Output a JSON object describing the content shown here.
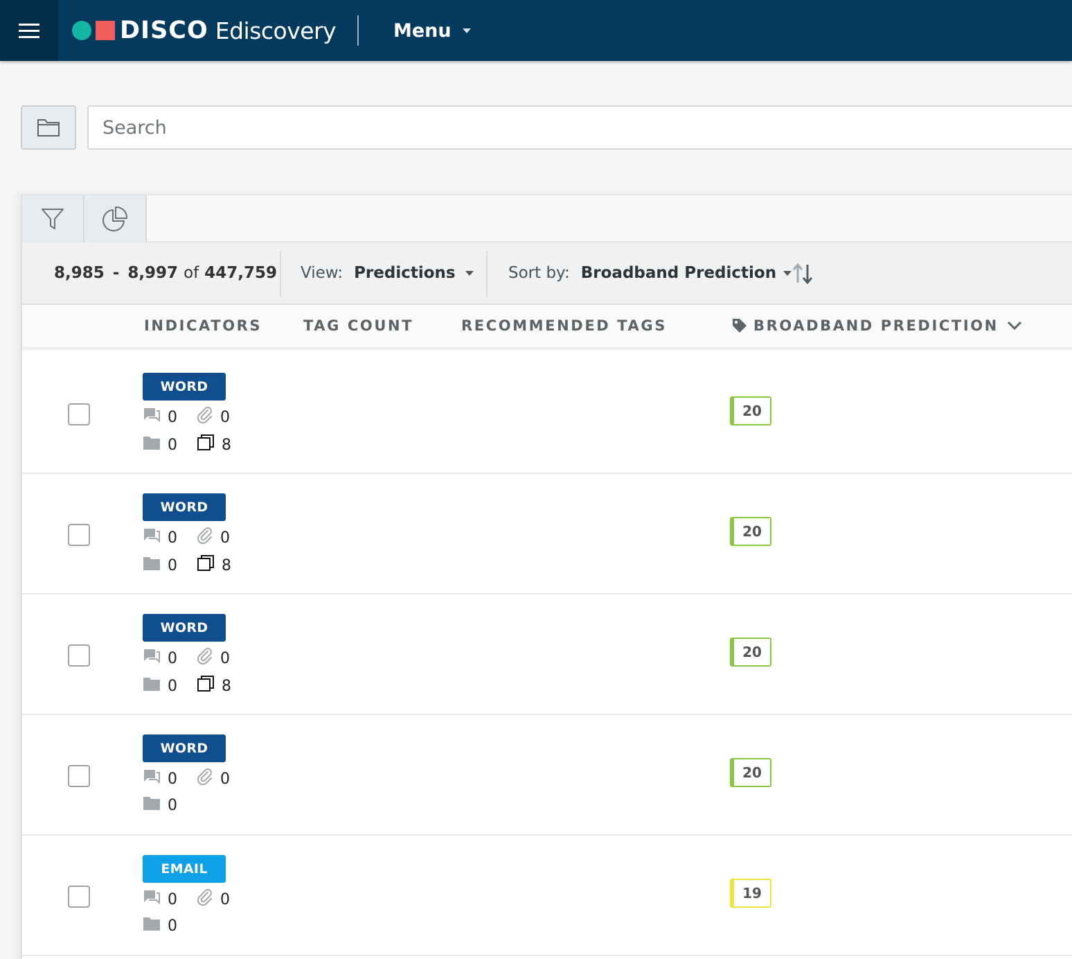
{
  "nav": {
    "brand": "DISCO",
    "product": "Ediscovery",
    "menu_label": "Menu",
    "colors": {
      "bar": "#033a5e",
      "logo_dot": "#13b6a4",
      "logo_square": "#f25d5d"
    }
  },
  "search": {
    "placeholder": "Search",
    "value": ""
  },
  "toolbar": {
    "range_start": "8,985",
    "range_sep": "-",
    "range_end": "8,997",
    "range_of": "of",
    "total": "447,759",
    "view_label": "View:",
    "view_value": "Predictions",
    "sort_label": "Sort by:",
    "sort_value": "Broadband Prediction"
  },
  "columns": {
    "indicators": "INDICATORS",
    "tag_count": "TAG COUNT",
    "recommended_tags": "RECOMMENDED TAGS",
    "broadband_prediction": "BROADBAND PREDICTION"
  },
  "rows": [
    {
      "type": "WORD",
      "type_color": "#114e8f",
      "comments": "0",
      "attachments": "0",
      "folders": "0",
      "versions": "8",
      "score": "20",
      "score_color": "#8cc63e"
    },
    {
      "type": "WORD",
      "type_color": "#114e8f",
      "comments": "0",
      "attachments": "0",
      "folders": "0",
      "versions": "8",
      "score": "20",
      "score_color": "#8cc63e"
    },
    {
      "type": "WORD",
      "type_color": "#114e8f",
      "comments": "0",
      "attachments": "0",
      "folders": "0",
      "versions": "8",
      "score": "20",
      "score_color": "#8cc63e"
    },
    {
      "type": "WORD",
      "type_color": "#114e8f",
      "comments": "0",
      "attachments": "0",
      "folders": "0",
      "versions": null,
      "score": "20",
      "score_color": "#8cc63e"
    },
    {
      "type": "EMAIL",
      "type_color": "#0fa0ea",
      "comments": "0",
      "attachments": "0",
      "folders": "0",
      "versions": null,
      "score": "19",
      "score_color": "#ece53a"
    }
  ]
}
